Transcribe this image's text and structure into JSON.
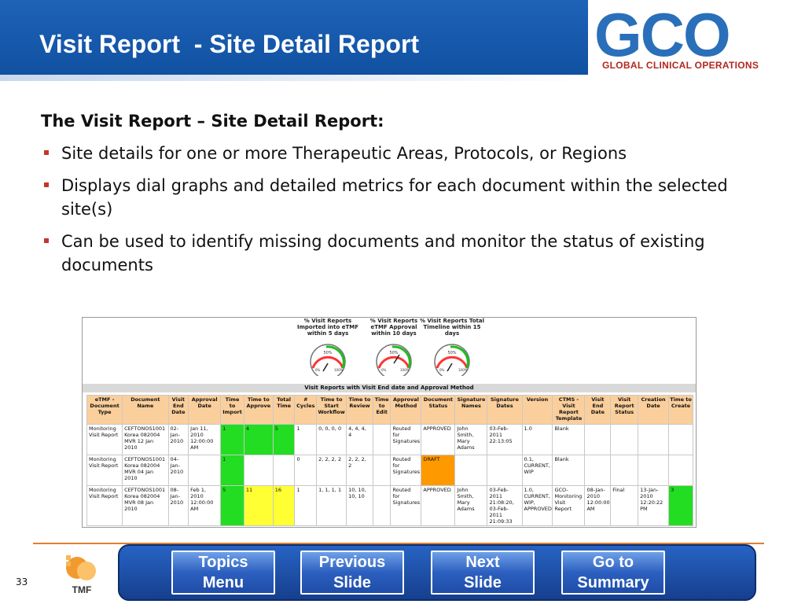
{
  "slide": {
    "title": "Visit Report  - Site Detail Report",
    "page_number": "33"
  },
  "logo": {
    "word": "GCO",
    "subtitle": "GLOBAL CLINICAL OPERATIONS"
  },
  "body": {
    "heading": "The Visit Report – Site Detail Report:",
    "bullets": [
      "Site details for one or more Therapeutic Areas, Protocols, or Regions",
      "Displays dial graphs and detailed metrics for each document within the selected site(s)",
      "Can be used to identify missing documents and monitor the status of existing documents"
    ]
  },
  "report": {
    "dials": [
      {
        "caption": "% Visit Reports Imported into eTMF within 5 days",
        "mid": "50%",
        "min": "0%",
        "max": "100%"
      },
      {
        "caption": "% Visit Reports eTMF Approval within 10 days",
        "mid": "50%",
        "min": "0%",
        "max": "100%"
      },
      {
        "caption": "% Visit Reports Total Timeline within 15 days",
        "mid": "50%",
        "min": "0%",
        "max": "100%"
      }
    ],
    "band_title": "Visit Reports with Visit End date and Approval Method",
    "columns": [
      "eTMF - Document Type",
      "Document Name",
      "Visit End Date",
      "Approval Date",
      "Time to Import",
      "Time to Approve",
      "Total Time",
      "# Cycles",
      "Time to Start Workflow",
      "Time to Review",
      "Time to Edit",
      "Approval Method",
      "Document Status",
      "Signature Names",
      "Signature Dates",
      "Version",
      "CTMS - Visit Report Template",
      "Visit End Date",
      "Visit Report Status",
      "Creation Date",
      "Time to Create"
    ],
    "rows": [
      [
        "Monitoring Visit Report",
        "CEFTONOS1001 Korea 082004 MVR 12 Jan 2010",
        "02-Jan-2010",
        "Jan 11, 2010 12:00:00 AM",
        "1",
        "4",
        "5",
        "1",
        "0, 0, 0, 0",
        "4, 4, 4, 4",
        "",
        "Routed for Signatures",
        "APPROVED",
        "John Smith, Mary Adams",
        "03-Feb-2011 22:13:05",
        "1.0",
        "Blank",
        "",
        "",
        "",
        ""
      ],
      [
        "Monitoring Visit Report",
        "CEFTONOS1001 Korea 082004 MVR 04 Jan 2010",
        "04-Jan-2010",
        "",
        "1",
        "",
        "",
        "0",
        "2, 2, 2, 2",
        "2, 2, 2, 2",
        "",
        "Routed for Signatures",
        "DRAFT",
        "",
        "",
        "0.1, CURRENT, WIP",
        "Blank",
        "",
        "",
        "",
        ""
      ],
      [
        "Monitoring Visit Report",
        "CEFTONOS1001 Korea 082004 MVR 08 Jan 2010",
        "08-Jan-2010",
        "Feb 1, 2010 12:00:00 AM",
        "5",
        "11",
        "16",
        "1",
        "1, 1, 1, 1",
        "10, 10, 10, 10",
        "",
        "Routed for Signatures",
        "APPROVED",
        "John Smith, Mary Adams",
        "03-Feb-2011 21:08:20, 03-Feb-2011 21:09:33",
        "1.0, CURRENT, WIP, APPROVED",
        "GCO-Monitoring Visit Report",
        "08-Jan-2010 12:00:00 AM",
        "Final",
        "13-Jan-2010 12:20:22 PM",
        "3"
      ]
    ],
    "cell_colors": {
      "green": "#22dd22",
      "yellow": "#ffff33",
      "orange": "#ff9900"
    }
  },
  "footer": {
    "tmf_label": "TMF",
    "nav": [
      {
        "line1": "Topics",
        "line2": "Menu"
      },
      {
        "line1": "Previous",
        "line2": "Slide"
      },
      {
        "line1": "Next",
        "line2": "Slide"
      },
      {
        "line1": "Go to",
        "line2": "Summary"
      }
    ]
  },
  "colors": {
    "header_blue": "#1e63b8",
    "accent_orange": "#e57d2e",
    "bullet_red": "#c0392b",
    "table_header": "#fbcf9c"
  }
}
